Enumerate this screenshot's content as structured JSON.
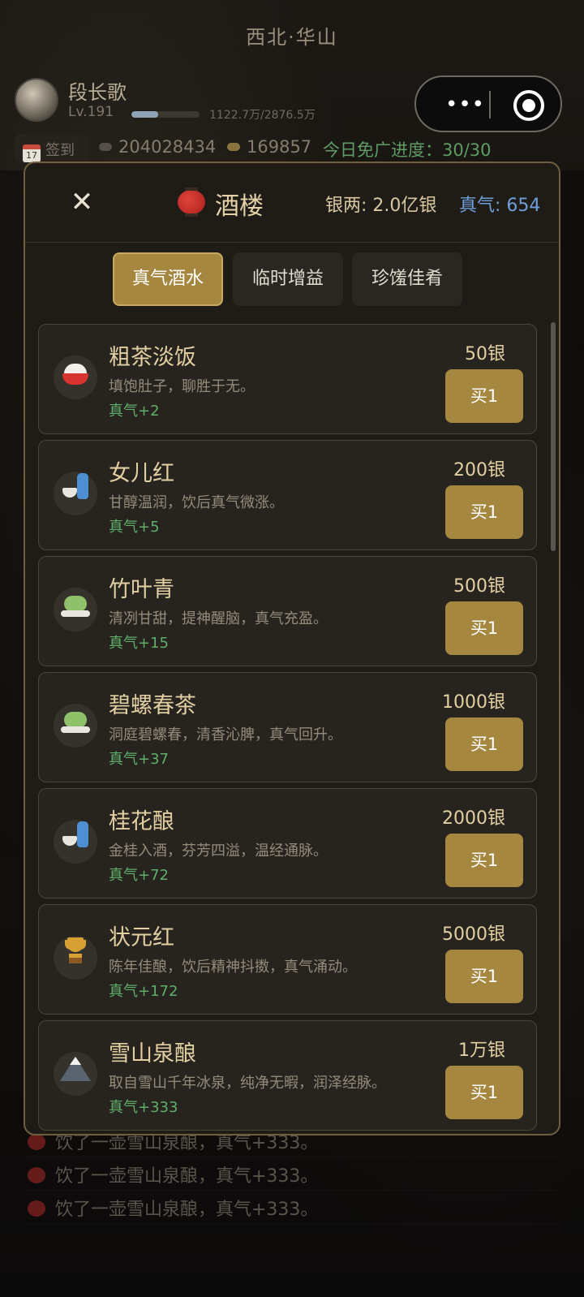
{
  "header": {
    "location": "西北·华山"
  },
  "player": {
    "name": "段长歌",
    "level": "Lv.191",
    "exp_text": "1122.7万/2876.5万",
    "exp_fraction": 0.39
  },
  "resources": {
    "signin_label": "签到",
    "signin_day": "17",
    "currency_a": "204028434",
    "currency_b": "169857",
    "ad_progress": "今日免广进度：30/30"
  },
  "modal": {
    "title": "酒楼",
    "silver": "银两: 2.0亿银",
    "qi": "真气: 654",
    "tabs": [
      {
        "label": "真气酒水",
        "active": true
      },
      {
        "label": "临时增益",
        "active": false
      },
      {
        "label": "珍馐佳肴",
        "active": false
      }
    ],
    "buy_label": "买1",
    "items": [
      {
        "icon": "rice-bowl-icon",
        "name": "粗茶淡饭",
        "desc": "填饱肚子，聊胜于无。",
        "effect": "真气+2",
        "price": "50银"
      },
      {
        "icon": "sake-icon",
        "name": "女儿红",
        "desc": "甘醇温润，饮后真气微涨。",
        "effect": "真气+5",
        "price": "200银"
      },
      {
        "icon": "green-tea-icon",
        "name": "竹叶青",
        "desc": "清冽甘甜，提神醒脑，真气充盈。",
        "effect": "真气+15",
        "price": "500银"
      },
      {
        "icon": "green-tea-icon",
        "name": "碧螺春茶",
        "desc": "洞庭碧螺春，清香沁脾，真气回升。",
        "effect": "真气+37",
        "price": "1000银"
      },
      {
        "icon": "sake-icon",
        "name": "桂花酿",
        "desc": "金桂入酒，芬芳四溢，温经通脉。",
        "effect": "真气+72",
        "price": "2000银"
      },
      {
        "icon": "trophy-icon",
        "name": "状元红",
        "desc": "陈年佳酿，饮后精神抖擞，真气涌动。",
        "effect": "真气+172",
        "price": "5000银"
      },
      {
        "icon": "snow-mountain-icon",
        "name": "雪山泉酿",
        "desc": "取自雪山千年冰泉，纯净无暇，润泽经脉。",
        "effect": "真气+333",
        "price": "1万银"
      }
    ]
  },
  "log": [
    "饮了一壶雪山泉酿，真气+333。",
    "饮了一壶雪山泉酿，真气+333。",
    "饮了一壶雪山泉酿，真气+333。"
  ],
  "colors": {
    "accent_gold": "#a6873f",
    "effect_green": "#5fae6a",
    "qi_blue": "#6f9fd8"
  }
}
